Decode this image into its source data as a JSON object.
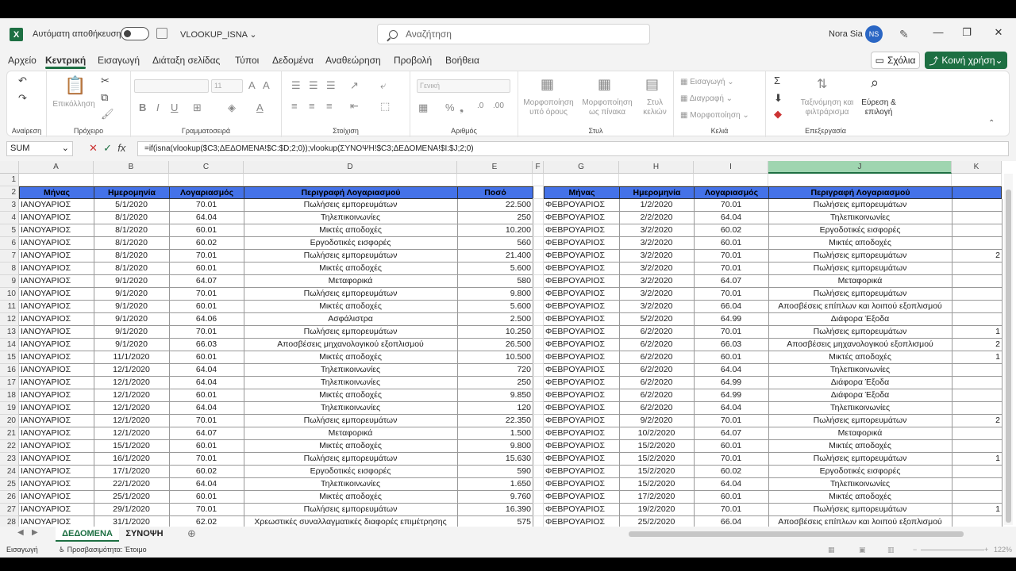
{
  "window": {
    "autosave_label": "Αυτόματη αποθήκευση",
    "doc_name": "VLOOKUP_ISNA",
    "search_placeholder": "Αναζήτηση",
    "user_name": "Nora Sia",
    "user_initials": "NS"
  },
  "tabs": [
    "Αρχείο",
    "Κεντρική",
    "Εισαγωγή",
    "Διάταξη σελίδας",
    "Τύποι",
    "Δεδομένα",
    "Αναθεώρηση",
    "Προβολή",
    "Βοήθεια"
  ],
  "active_tab": "Κεντρική",
  "actions": {
    "comments": "Σχόλια",
    "share": "Κοινή χρήση"
  },
  "ribbon": {
    "undo_group": "Αναίρεση",
    "clipboard_group": "Πρόχειρο",
    "paste_label": "Επικόλληση",
    "font_group": "Γραμματοσειρά",
    "font_size": "11",
    "alignment_group": "Στοίχιση",
    "number_group": "Αριθμός",
    "number_format": "Γενική",
    "styles_group": "Στυλ",
    "conditional_formatting": "Μορφοποίηση υπό όρους",
    "format_as_table": "Μορφοποίηση ως πίνακα",
    "cell_styles": "Στυλ κελιών",
    "cells_group": "Κελιά",
    "insert": "Εισαγωγή",
    "delete": "Διαγραφή",
    "format": "Μορφοποίηση",
    "editing_group": "Επεξεργασία",
    "sort_filter": "Ταξινόμηση και φιλτράρισμα",
    "find_select": "Εύρεση & επιλογή"
  },
  "formula_bar": {
    "name_box": "SUM",
    "formula": "=if(isna(vlookup($C3;ΔΕΔΟΜΕΝΑ!$C:$D;2;0));vlookup(ΣΥΝΟΨΗ!$C3;ΔΕΔΟΜΕΝΑ!$I:$J;2;0)"
  },
  "columns": [
    "A",
    "B",
    "C",
    "D",
    "E",
    "F",
    "G",
    "H",
    "I",
    "J",
    "K"
  ],
  "selected_column": "J",
  "headers_left": [
    "Μήνας",
    "Ημερομηνία",
    "Λογαριασμός",
    "Περιγραφή Λογαριασμού",
    "Ποσό"
  ],
  "headers_right": [
    "Μήνας",
    "Ημερομηνία",
    "Λογαριασμός",
    "Περιγραφή Λογαριασμού"
  ],
  "rows_left": [
    [
      "ΙΑΝΟΥΑΡΙΟΣ",
      "5/1/2020",
      "70.01",
      "Πωλήσεις εμπορευμάτων",
      "22.500"
    ],
    [
      "ΙΑΝΟΥΑΡΙΟΣ",
      "8/1/2020",
      "64.04",
      "Τηλεπικοινωνίες",
      "250"
    ],
    [
      "ΙΑΝΟΥΑΡΙΟΣ",
      "8/1/2020",
      "60.01",
      "Μικτές αποδοχές",
      "10.200"
    ],
    [
      "ΙΑΝΟΥΑΡΙΟΣ",
      "8/1/2020",
      "60.02",
      "Εργοδοτικές εισφορές",
      "560"
    ],
    [
      "ΙΑΝΟΥΑΡΙΟΣ",
      "8/1/2020",
      "70.01",
      "Πωλήσεις εμπορευμάτων",
      "21.400"
    ],
    [
      "ΙΑΝΟΥΑΡΙΟΣ",
      "8/1/2020",
      "60.01",
      "Μικτές αποδοχές",
      "5.600"
    ],
    [
      "ΙΑΝΟΥΑΡΙΟΣ",
      "9/1/2020",
      "64.07",
      "Μεταφορικά",
      "580"
    ],
    [
      "ΙΑΝΟΥΑΡΙΟΣ",
      "9/1/2020",
      "70.01",
      "Πωλήσεις εμπορευμάτων",
      "9.800"
    ],
    [
      "ΙΑΝΟΥΑΡΙΟΣ",
      "9/1/2020",
      "60.01",
      "Μικτές αποδοχές",
      "5.600"
    ],
    [
      "ΙΑΝΟΥΑΡΙΟΣ",
      "9/1/2020",
      "64.06",
      "Ασφάλιστρα",
      "2.500"
    ],
    [
      "ΙΑΝΟΥΑΡΙΟΣ",
      "9/1/2020",
      "70.01",
      "Πωλήσεις εμπορευμάτων",
      "10.250"
    ],
    [
      "ΙΑΝΟΥΑΡΙΟΣ",
      "9/1/2020",
      "66.03",
      "Αποσβέσεις μηχανολογικού εξοπλισμού",
      "26.500"
    ],
    [
      "ΙΑΝΟΥΑΡΙΟΣ",
      "11/1/2020",
      "60.01",
      "Μικτές αποδοχές",
      "10.500"
    ],
    [
      "ΙΑΝΟΥΑΡΙΟΣ",
      "12/1/2020",
      "64.04",
      "Τηλεπικοινωνίες",
      "720"
    ],
    [
      "ΙΑΝΟΥΑΡΙΟΣ",
      "12/1/2020",
      "64.04",
      "Τηλεπικοινωνίες",
      "250"
    ],
    [
      "ΙΑΝΟΥΑΡΙΟΣ",
      "12/1/2020",
      "60.01",
      "Μικτές αποδοχές",
      "9.850"
    ],
    [
      "ΙΑΝΟΥΑΡΙΟΣ",
      "12/1/2020",
      "64.04",
      "Τηλεπικοινωνίες",
      "120"
    ],
    [
      "ΙΑΝΟΥΑΡΙΟΣ",
      "12/1/2020",
      "70.01",
      "Πωλήσεις εμπορευμάτων",
      "22.350"
    ],
    [
      "ΙΑΝΟΥΑΡΙΟΣ",
      "12/1/2020",
      "64.07",
      "Μεταφορικά",
      "1.500"
    ],
    [
      "ΙΑΝΟΥΑΡΙΟΣ",
      "15/1/2020",
      "60.01",
      "Μικτές αποδοχές",
      "9.800"
    ],
    [
      "ΙΑΝΟΥΑΡΙΟΣ",
      "16/1/2020",
      "70.01",
      "Πωλήσεις εμπορευμάτων",
      "15.630"
    ],
    [
      "ΙΑΝΟΥΑΡΙΟΣ",
      "17/1/2020",
      "60.02",
      "Εργοδοτικές εισφορές",
      "590"
    ],
    [
      "ΙΑΝΟΥΑΡΙΟΣ",
      "22/1/2020",
      "64.04",
      "Τηλεπικοινωνίες",
      "1.650"
    ],
    [
      "ΙΑΝΟΥΑΡΙΟΣ",
      "25/1/2020",
      "60.01",
      "Μικτές αποδοχές",
      "9.760"
    ],
    [
      "ΙΑΝΟΥΑΡΙΟΣ",
      "29/1/2020",
      "70.01",
      "Πωλήσεις εμπορευμάτων",
      "16.390"
    ],
    [
      "ΙΑΝΟΥΑΡΙΟΣ",
      "31/1/2020",
      "62.02",
      "Χρεωστικές συναλλαγματικές διαφορές επιμέτρησης",
      "575"
    ]
  ],
  "rows_right": [
    [
      "ΦΕΒΡΟΥΑΡΙΟΣ",
      "1/2/2020",
      "70.01",
      "Πωλήσεις εμπορευμάτων",
      ""
    ],
    [
      "ΦΕΒΡΟΥΑΡΙΟΣ",
      "2/2/2020",
      "64.04",
      "Τηλεπικοινωνίες",
      ""
    ],
    [
      "ΦΕΒΡΟΥΑΡΙΟΣ",
      "3/2/2020",
      "60.02",
      "Εργοδοτικές εισφορές",
      ""
    ],
    [
      "ΦΕΒΡΟΥΑΡΙΟΣ",
      "3/2/2020",
      "60.01",
      "Μικτές αποδοχές",
      ""
    ],
    [
      "ΦΕΒΡΟΥΑΡΙΟΣ",
      "3/2/2020",
      "70.01",
      "Πωλήσεις εμπορευμάτων",
      "2"
    ],
    [
      "ΦΕΒΡΟΥΑΡΙΟΣ",
      "3/2/2020",
      "70.01",
      "Πωλήσεις εμπορευμάτων",
      ""
    ],
    [
      "ΦΕΒΡΟΥΑΡΙΟΣ",
      "3/2/2020",
      "64.07",
      "Μεταφορικά",
      ""
    ],
    [
      "ΦΕΒΡΟΥΑΡΙΟΣ",
      "3/2/2020",
      "70.01",
      "Πωλήσεις εμπορευμάτων",
      ""
    ],
    [
      "ΦΕΒΡΟΥΑΡΙΟΣ",
      "3/2/2020",
      "66.04",
      "Αποσβέσεις επίπλων και λοιπού εξοπλισμού",
      ""
    ],
    [
      "ΦΕΒΡΟΥΑΡΙΟΣ",
      "5/2/2020",
      "64.99",
      "Διάφορα Έξοδα",
      ""
    ],
    [
      "ΦΕΒΡΟΥΑΡΙΟΣ",
      "6/2/2020",
      "70.01",
      "Πωλήσεις εμπορευμάτων",
      "1"
    ],
    [
      "ΦΕΒΡΟΥΑΡΙΟΣ",
      "6/2/2020",
      "66.03",
      "Αποσβέσεις μηχανολογικού εξοπλισμού",
      "2"
    ],
    [
      "ΦΕΒΡΟΥΑΡΙΟΣ",
      "6/2/2020",
      "60.01",
      "Μικτές αποδοχές",
      "1"
    ],
    [
      "ΦΕΒΡΟΥΑΡΙΟΣ",
      "6/2/2020",
      "64.04",
      "Τηλεπικοινωνίες",
      ""
    ],
    [
      "ΦΕΒΡΟΥΑΡΙΟΣ",
      "6/2/2020",
      "64.99",
      "Διάφορα Έξοδα",
      ""
    ],
    [
      "ΦΕΒΡΟΥΑΡΙΟΣ",
      "6/2/2020",
      "64.99",
      "Διάφορα Έξοδα",
      ""
    ],
    [
      "ΦΕΒΡΟΥΑΡΙΟΣ",
      "6/2/2020",
      "64.04",
      "Τηλεπικοινωνίες",
      ""
    ],
    [
      "ΦΕΒΡΟΥΑΡΙΟΣ",
      "9/2/2020",
      "70.01",
      "Πωλήσεις εμπορευμάτων",
      "2"
    ],
    [
      "ΦΕΒΡΟΥΑΡΙΟΣ",
      "10/2/2020",
      "64.07",
      "Μεταφορικά",
      ""
    ],
    [
      "ΦΕΒΡΟΥΑΡΙΟΣ",
      "15/2/2020",
      "60.01",
      "Μικτές αποδοχές",
      ""
    ],
    [
      "ΦΕΒΡΟΥΑΡΙΟΣ",
      "15/2/2020",
      "70.01",
      "Πωλήσεις εμπορευμάτων",
      "1"
    ],
    [
      "ΦΕΒΡΟΥΑΡΙΟΣ",
      "15/2/2020",
      "60.02",
      "Εργοδοτικές εισφορές",
      ""
    ],
    [
      "ΦΕΒΡΟΥΑΡΙΟΣ",
      "15/2/2020",
      "64.04",
      "Τηλεπικοινωνίες",
      ""
    ],
    [
      "ΦΕΒΡΟΥΑΡΙΟΣ",
      "17/2/2020",
      "60.01",
      "Μικτές αποδοχές",
      ""
    ],
    [
      "ΦΕΒΡΟΥΑΡΙΟΣ",
      "19/2/2020",
      "70.01",
      "Πωλήσεις εμπορευμάτων",
      "1"
    ],
    [
      "ΦΕΒΡΟΥΑΡΙΟΣ",
      "25/2/2020",
      "66.04",
      "Αποσβέσεις επίπλων και λοιπού εξοπλισμού",
      ""
    ]
  ],
  "sheet_tabs": [
    "ΔΕΔΟΜΕΝΑ",
    "ΣΥΝΟΨΗ"
  ],
  "active_sheet": "ΔΕΔΟΜΕΝΑ",
  "status": {
    "mode": "Εισαγωγή",
    "accessibility": "Προσβασιμότητα: Έτοιμο",
    "zoom": "122%"
  },
  "colors": {
    "accent": "#1d6f42",
    "header_fill": "#4472e8"
  }
}
